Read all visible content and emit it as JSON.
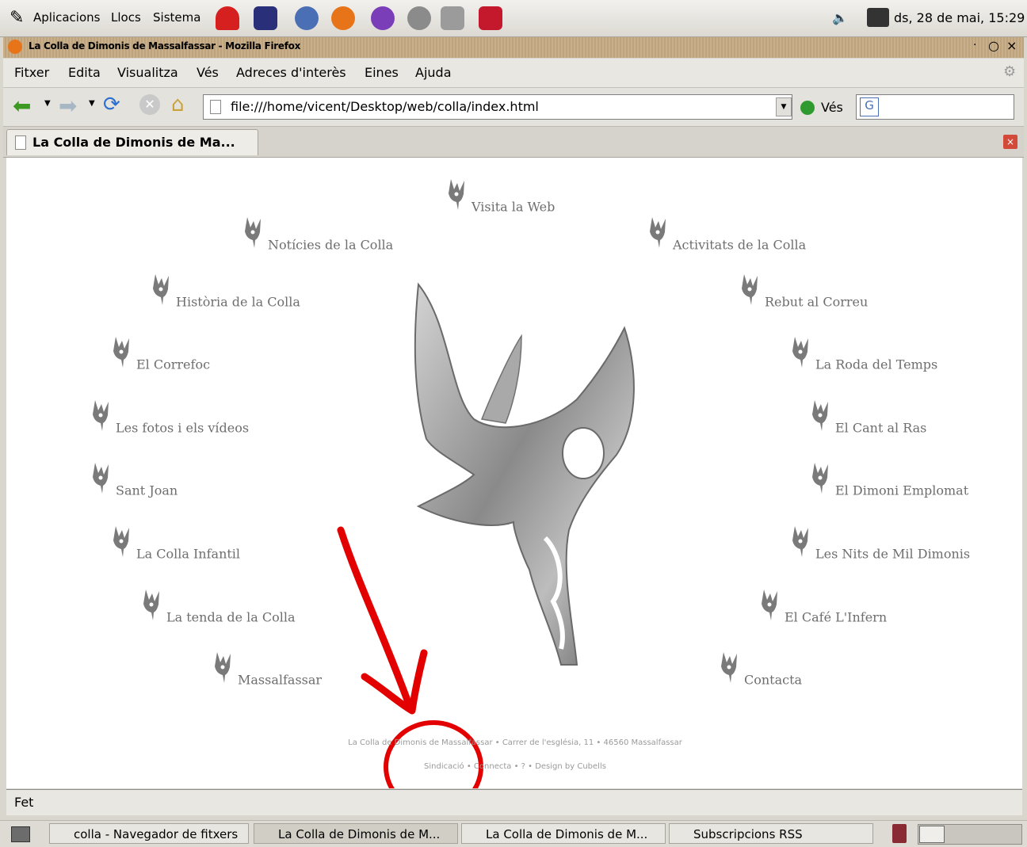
{
  "panel": {
    "menu": [
      "Aplicacions",
      "Llocs",
      "Sistema"
    ],
    "clock": "ds, 28 de mai, 15:29"
  },
  "window": {
    "title": "La Colla de Dimonis de Massalfassar - Mozilla Firefox",
    "menu": [
      "Fitxer",
      "Edita",
      "Visualitza",
      "Vés",
      "Adreces d'interès",
      "Eines",
      "Ajuda"
    ],
    "url": "file:///home/vicent/Desktop/web/colla/index.html",
    "go_label": "Vés",
    "tab_label": "La Colla de Dimonis de Ma..."
  },
  "page": {
    "links": [
      "Visita la Web",
      "Notícies de la Colla",
      "Activitats de la Colla",
      "Història de la Colla",
      "Rebut al Correu",
      "El Correfoc",
      "La Roda del Temps",
      "Les fotos i els vídeos",
      "El Cant al Ras",
      "Sant Joan",
      "El Dimoni Emplomat",
      "La Colla Infantil",
      "Les Nits de Mil Dimonis",
      "La tenda de la Colla",
      "El Café L'Infern",
      "Massalfassar",
      "Contacta"
    ],
    "footer_line1": "La Colla de Dimonis de Massalfassar • Carrer de l'església, 11 • 46560 Massalfassar",
    "footer_line2": "Sindicació • Connecta • ? • Design by Cubells"
  },
  "status": "Fet",
  "taskbar": {
    "items": [
      "colla - Navegador de fitxers",
      "La Colla de Dimonis de M...",
      "La Colla de Dimonis de M...",
      "Subscripcions RSS"
    ]
  },
  "colors": {
    "annotation": "#e30000",
    "link": "#6e6e6e"
  }
}
